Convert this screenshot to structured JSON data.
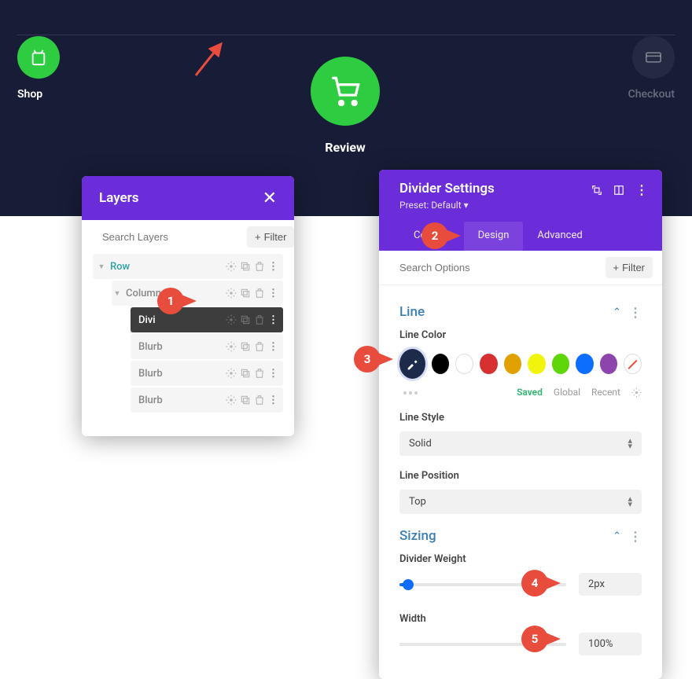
{
  "header": {
    "shop_label": "Shop",
    "review_label": "Review",
    "checkout_label": "Checkout"
  },
  "layers_panel": {
    "title": "Layers",
    "search_placeholder": "Search Layers",
    "filter_label": "Filter",
    "items": {
      "row": "Row",
      "column": "Column",
      "divider": "Divi",
      "blurb": "Blurb"
    }
  },
  "settings_panel": {
    "title": "Divider Settings",
    "preset": "Preset: Default",
    "tabs": {
      "content": "Content",
      "design": "Design",
      "advanced": "Advanced"
    },
    "search_placeholder": "Search Options",
    "filter_label": "Filter",
    "sections": {
      "line": {
        "title": "Line",
        "line_color_label": "Line Color",
        "color_tabs": {
          "saved": "Saved",
          "global": "Global",
          "recent": "Recent"
        },
        "swatches": [
          "#1d2a4a",
          "#000000",
          "#ffffff",
          "#d63031",
          "#e1a100",
          "#f1f50d",
          "#5fd60a",
          "#0d6efd",
          "#8e44ad",
          "none"
        ],
        "line_style_label": "Line Style",
        "line_style_value": "Solid",
        "line_position_label": "Line Position",
        "line_position_value": "Top"
      },
      "sizing": {
        "title": "Sizing",
        "divider_weight_label": "Divider Weight",
        "divider_weight_value": "2px",
        "divider_weight_pct": 5,
        "width_label": "Width",
        "width_value": "100%",
        "width_pct": 100
      }
    }
  },
  "callouts": {
    "c1": "1",
    "c2": "2",
    "c3": "3",
    "c4": "4",
    "c5": "5"
  }
}
